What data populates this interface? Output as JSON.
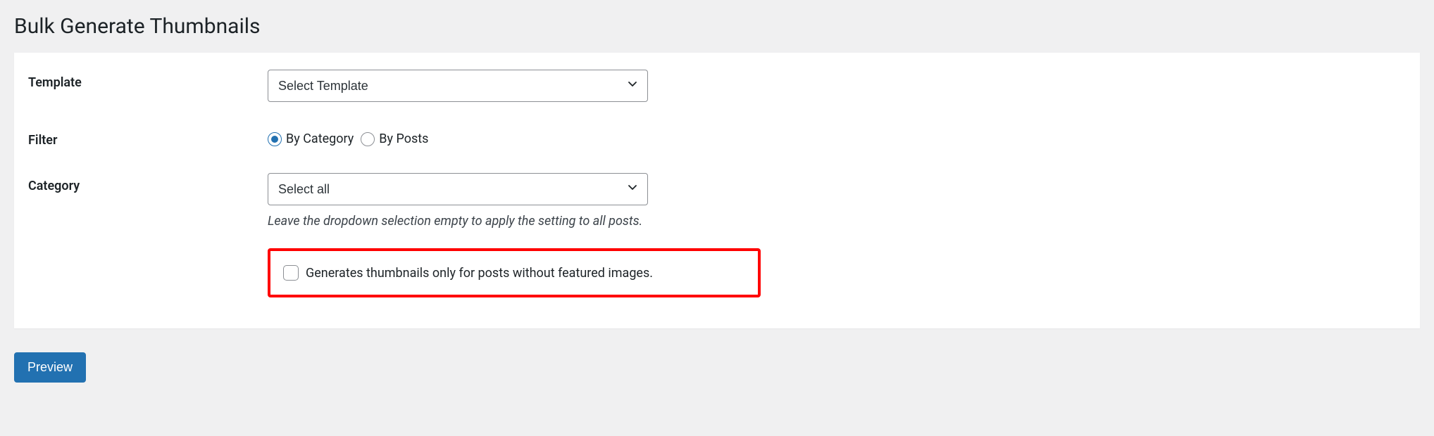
{
  "page": {
    "title": "Bulk Generate Thumbnails"
  },
  "form": {
    "template": {
      "label": "Template",
      "selected": "Select Template"
    },
    "filter": {
      "label": "Filter",
      "options": {
        "by_category": "By Category",
        "by_posts": "By Posts"
      },
      "selected": "by_category"
    },
    "category": {
      "label": "Category",
      "selected": "Select all",
      "helper": "Leave the dropdown selection empty to apply the setting to all posts."
    },
    "only_without_featured": {
      "label": "Generates thumbnails only for posts without featured images.",
      "checked": false
    }
  },
  "actions": {
    "preview": "Preview"
  }
}
